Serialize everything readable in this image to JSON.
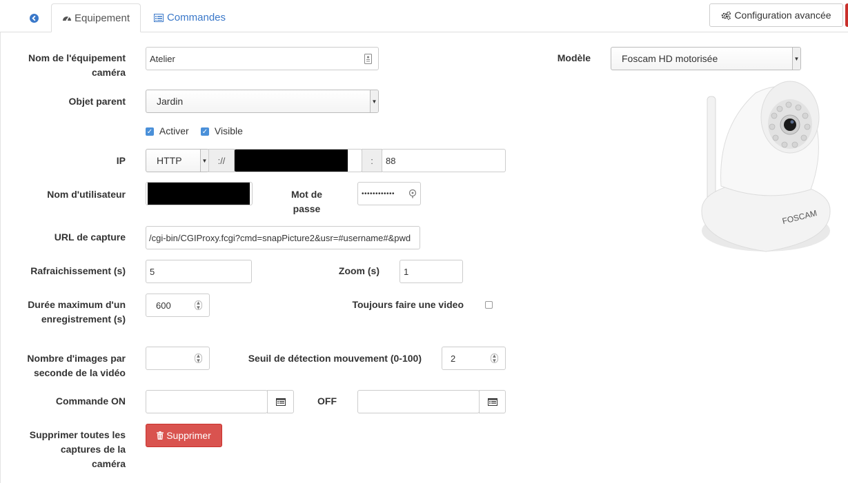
{
  "tabs": {
    "back_icon": "arrow-circle-left-icon",
    "equipment_label": "Equipement",
    "commands_label": "Commandes",
    "advanced_config_label": "Configuration avancée"
  },
  "form": {
    "name_label_line1": "Nom de l'équipement",
    "name_label_line2": "caméra",
    "name_value": "Atelier",
    "parent_label": "Objet parent",
    "parent_value": "Jardin",
    "activate_label": "Activer",
    "visible_label": "Visible",
    "activate_checked": true,
    "visible_checked": true,
    "ip_label": "IP",
    "protocol_value": "HTTP",
    "protocol_separator": "://",
    "port_separator": ":",
    "port_value": "88",
    "username_label": "Nom d'utilisateur",
    "password_label_line1": "Mot de",
    "password_label_line2": "passe",
    "password_value": "••••••••••••",
    "capture_url_label": "URL de capture",
    "capture_url_value": "/cgi-bin/CGIProxy.fcgi?cmd=snapPicture2&usr=#username#&pwd",
    "refresh_label": "Rafraichissement (s)",
    "refresh_value": "5",
    "zoom_label": "Zoom (s)",
    "zoom_value": "1",
    "max_duration_label_line1": "Durée maximum d'un",
    "max_duration_label_line2": "enregistrement (s)",
    "max_duration_value": "600",
    "always_video_label": "Toujours faire une video",
    "always_video_checked": false,
    "fps_label_line1": "Nombre d'images par",
    "fps_label_line2": "seconde de la vidéo",
    "fps_value": "",
    "motion_threshold_label": "Seuil de détection mouvement (0-100)",
    "motion_threshold_value": "2",
    "command_on_label": "Commande ON",
    "command_on_value": "",
    "off_label": "OFF",
    "off_value": "",
    "delete_captures_label_line1": "Supprimer toutes les",
    "delete_captures_label_line2": "captures de la",
    "delete_captures_label_line3": "caméra",
    "delete_button_label": "Supprimer"
  },
  "model": {
    "label": "Modèle",
    "value": "Foscam HD motorisée",
    "camera_brand_text": "FOSCAM"
  },
  "colors": {
    "link_blue": "#3a78c9",
    "danger_red": "#d9534f",
    "checkbox_blue": "#4a90d9"
  }
}
